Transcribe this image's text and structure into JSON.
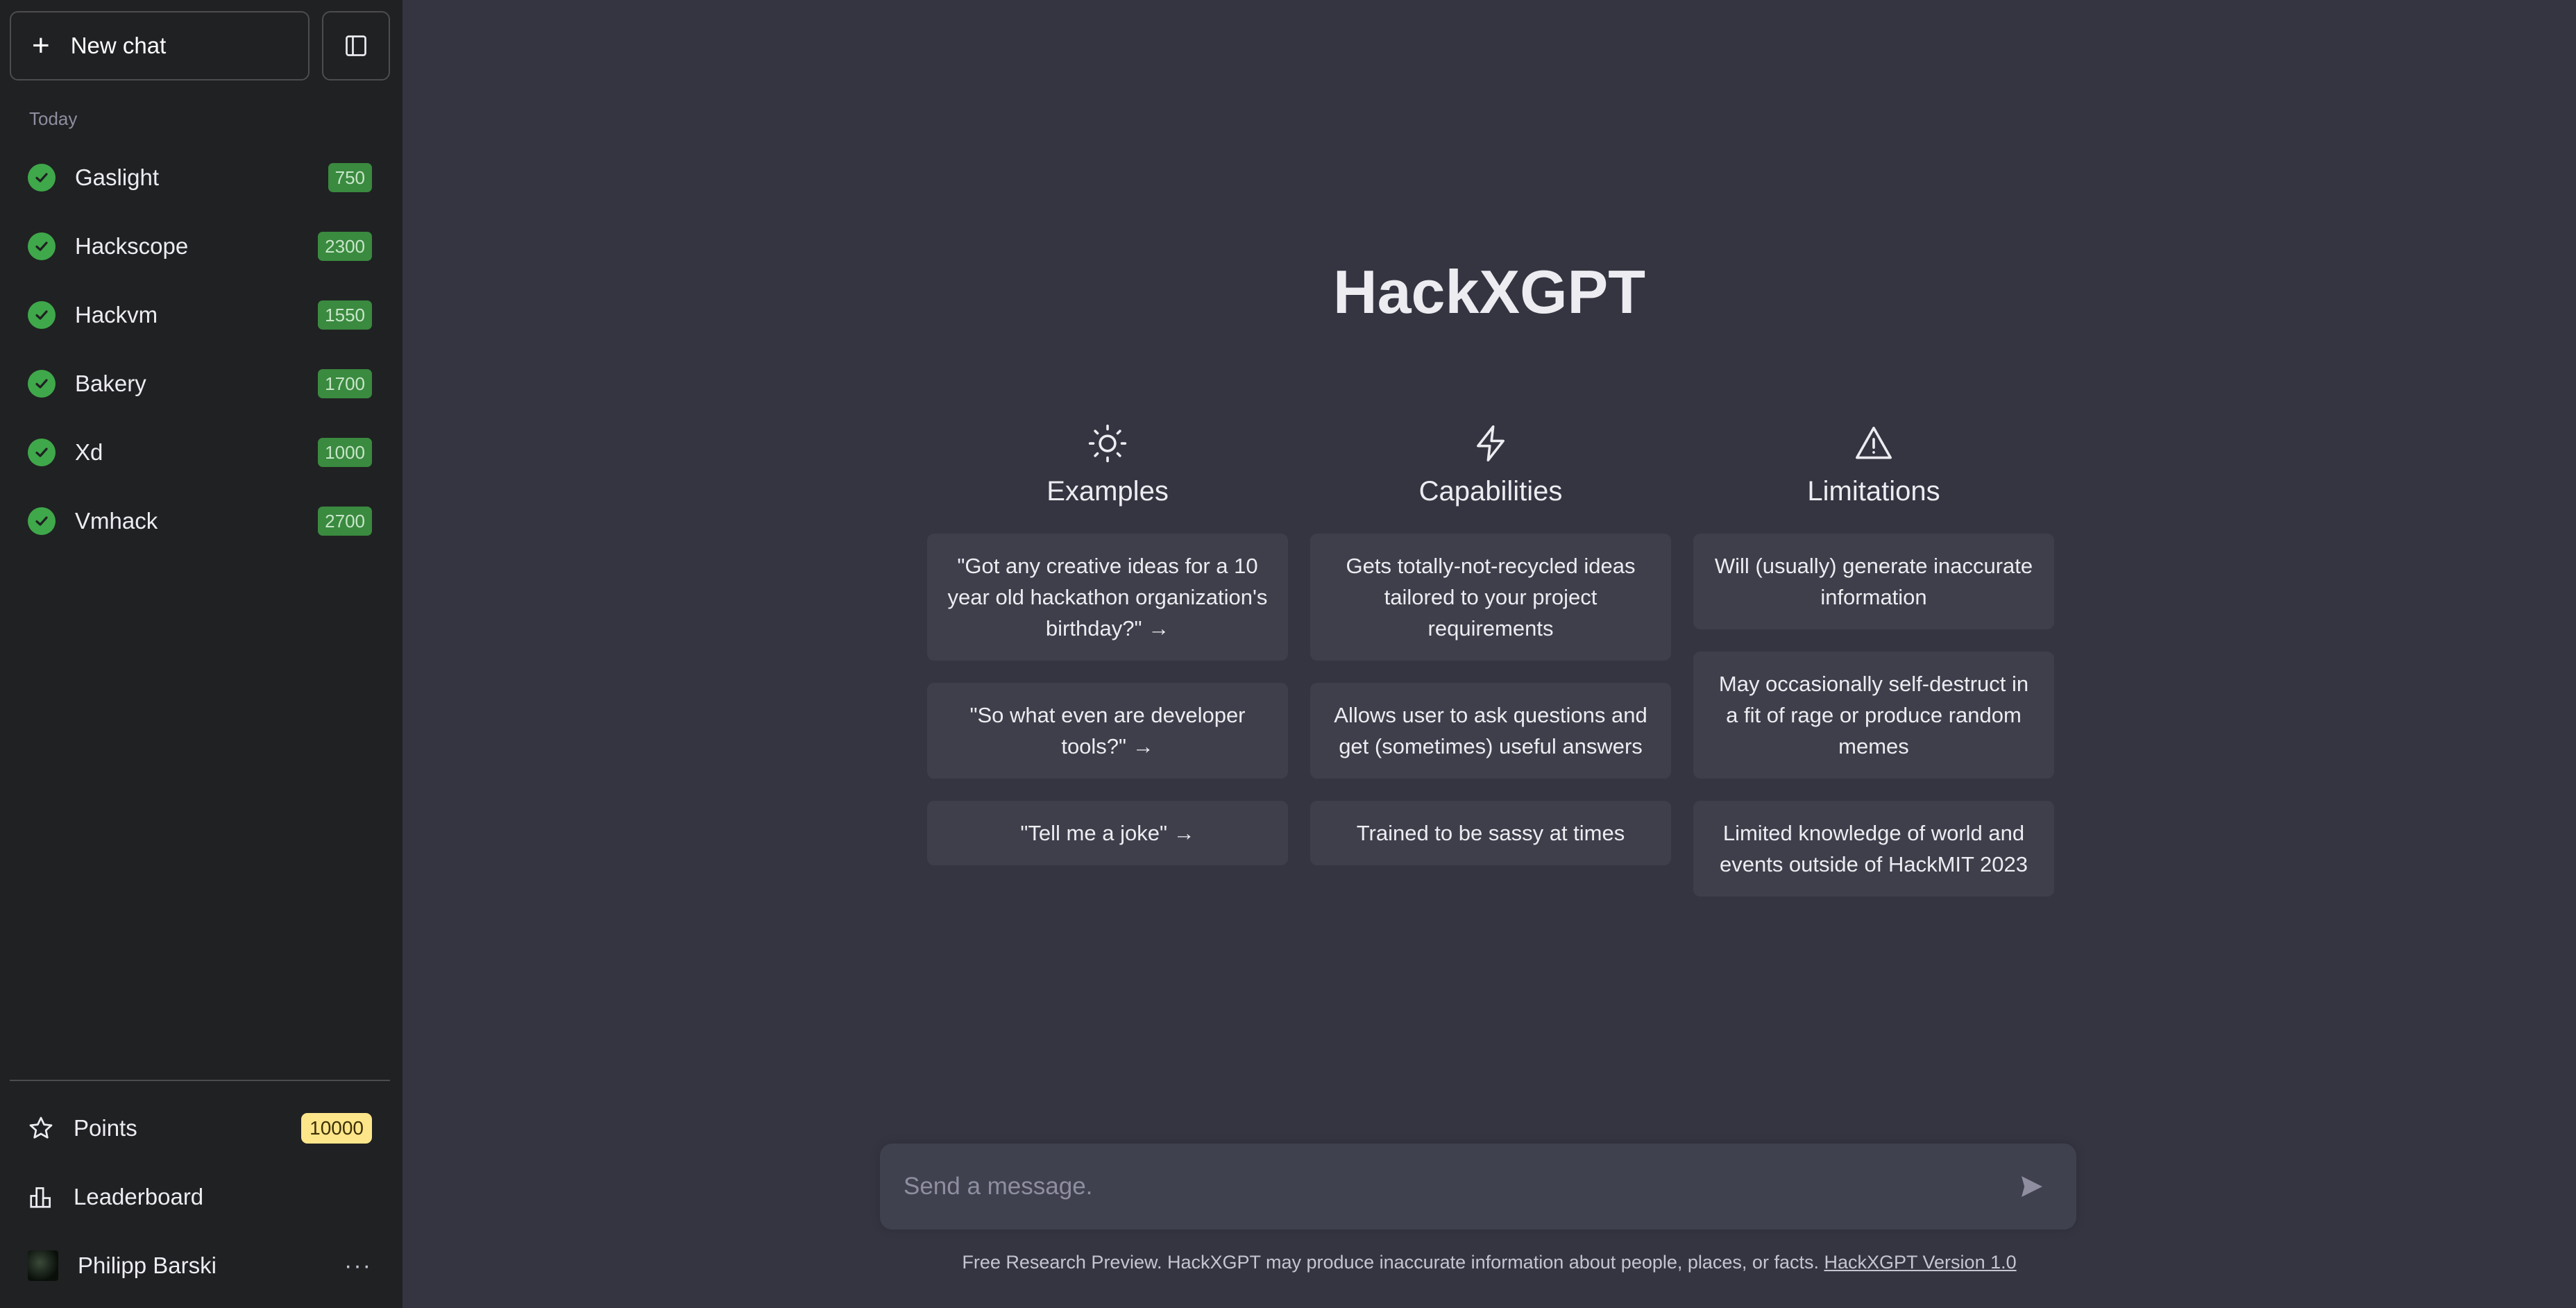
{
  "sidebar": {
    "new_chat_label": "New chat",
    "section_label": "Today",
    "chats": [
      {
        "title": "Gaslight",
        "points": "750"
      },
      {
        "title": "Hackscope",
        "points": "2300"
      },
      {
        "title": "Hackvm",
        "points": "1550"
      },
      {
        "title": "Bakery",
        "points": "1700"
      },
      {
        "title": "Xd",
        "points": "1000"
      },
      {
        "title": "Vmhack",
        "points": "2700"
      }
    ],
    "points_label": "Points",
    "points_value": "10000",
    "leaderboard_label": "Leaderboard",
    "user_name": "Philipp Barski",
    "more_label": "···"
  },
  "main": {
    "title": "HackXGPT",
    "columns": [
      {
        "icon": "sun-icon",
        "title": "Examples",
        "cards": [
          "\"Got any creative ideas for a 10 year old hackathon organization's birthday?\" →",
          "\"So what even are developer tools?\" →",
          "\"Tell me a joke\" →"
        ]
      },
      {
        "icon": "lightning-icon",
        "title": "Capabilities",
        "cards": [
          "Gets totally-not-recycled ideas tailored to your project requirements",
          "Allows user to ask questions and get (sometimes) useful answers",
          "Trained to be sassy at times"
        ]
      },
      {
        "icon": "warning-icon",
        "title": "Limitations",
        "cards": [
          "Will (usually) generate inaccurate information",
          "May occasionally self-destruct in a fit of rage or produce random memes",
          "Limited knowledge of world and events outside of HackMIT 2023"
        ]
      }
    ],
    "composer": {
      "placeholder": "Send a message."
    },
    "footer": {
      "text": "Free Research Preview. HackXGPT may produce inaccurate information about people, places, or facts.",
      "link": "HackXGPT Version 1.0"
    }
  },
  "colors": {
    "sidebar_bg": "#202123",
    "main_bg": "#343541",
    "card_bg": "#3e3f4b",
    "check_green": "#3fa84a",
    "points_badge": "#fde68a"
  }
}
